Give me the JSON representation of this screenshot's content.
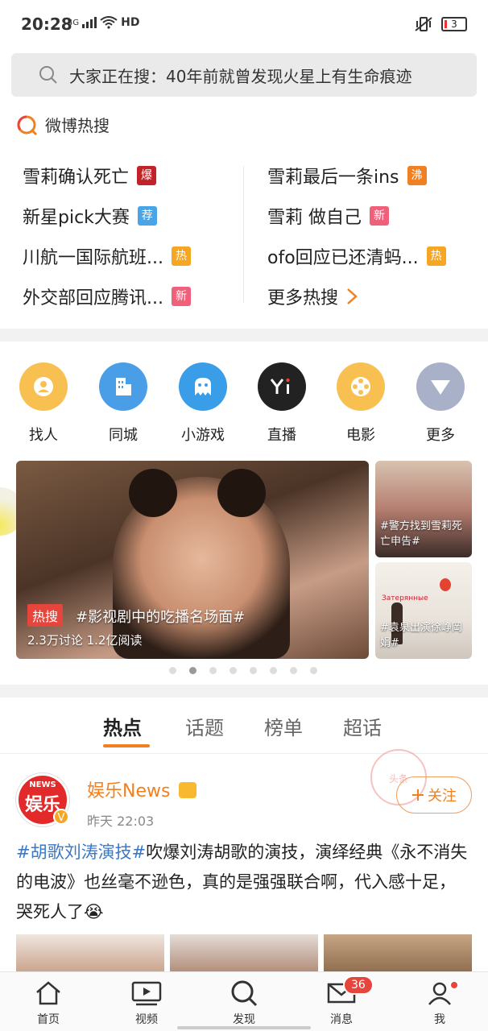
{
  "status_bar": {
    "time": "20:28",
    "network": "4G",
    "hd": "HD",
    "battery": "3"
  },
  "search": {
    "placeholder": "大家正在搜：40年前就曾发现火星上有生命痕迹"
  },
  "hot_search": {
    "title": "微博热搜",
    "items_left": [
      {
        "text": "雪莉确认死亡",
        "badge": "爆",
        "badge_color": "#c0242a"
      },
      {
        "text": "新星pick大赛",
        "badge": "荐",
        "badge_color": "#4aa5e8"
      },
      {
        "text": "川航一国际航班...",
        "badge": "热",
        "badge_color": "#f5a623"
      },
      {
        "text": "外交部回应腾讯...",
        "badge": "新",
        "badge_color": "#f0607a"
      }
    ],
    "items_right": [
      {
        "text": "雪莉最后一条ins",
        "badge": "沸",
        "badge_color": "#f08020"
      },
      {
        "text": "雪莉 做自己",
        "badge": "新",
        "badge_color": "#f0607a"
      },
      {
        "text": "ofo回应已还清蚂...",
        "badge": "热",
        "badge_color": "#f5a623"
      }
    ],
    "more": "更多热搜"
  },
  "quick_links": [
    {
      "label": "找人",
      "icon": "find-person-icon",
      "color": "#f8c050"
    },
    {
      "label": "同城",
      "icon": "city-icon",
      "color": "#4a9ee8"
    },
    {
      "label": "小游戏",
      "icon": "game-icon",
      "color": "#3a9de8"
    },
    {
      "label": "直播",
      "icon": "live-icon",
      "color": "#222222"
    },
    {
      "label": "电影",
      "icon": "film-icon",
      "color": "#f8c050"
    },
    {
      "label": "更多",
      "icon": "more-icon",
      "color": "#a9b1c8"
    }
  ],
  "banner": {
    "tag": "热搜",
    "title": "#影视剧中的吃播名场面#",
    "stats": "2.3万讨论  1.2亿阅读",
    "side_1": "#警方找到雪莉死亡申告#",
    "side_2": "#袁泉出演徐峥岡娟#",
    "side_2_overlay": "Затерянные"
  },
  "tabs": [
    "热点",
    "话题",
    "榜单",
    "超话"
  ],
  "post": {
    "avatar_top": "NEWS",
    "avatar_main": "娱乐",
    "user": "娱乐News",
    "time": "昨天 22:03",
    "follow": "关注",
    "stamp": "头条",
    "hashtag": "#胡歌刘涛演技#",
    "body": "吹爆刘涛胡歌的演技，演绎经典《永不消失的电波》也丝毫不逊色，真的是强强联合啊，代入感十足，哭死人了😭"
  },
  "bottom_nav": {
    "items": [
      "首页",
      "视频",
      "发现",
      "消息",
      "我"
    ],
    "message_count": "36"
  }
}
